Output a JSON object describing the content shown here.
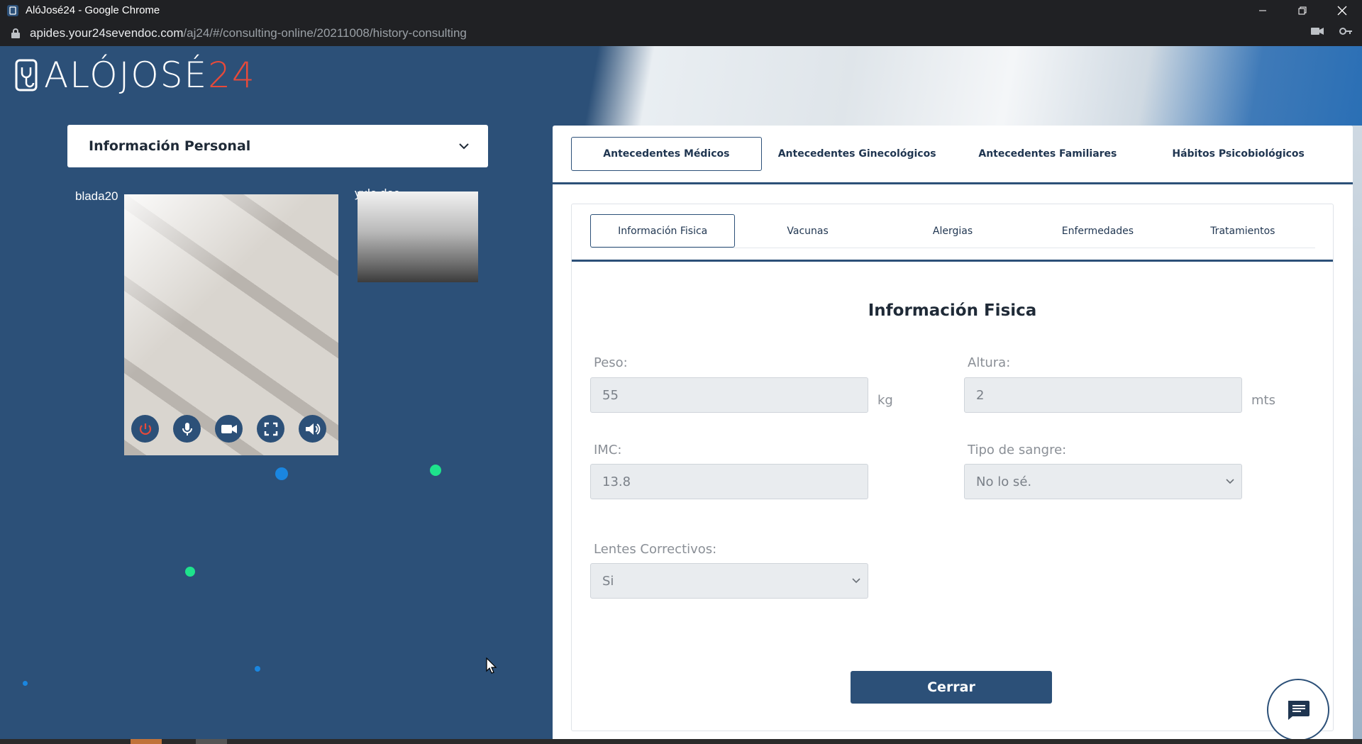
{
  "browser": {
    "window_title": "AlóJosé24 - Google Chrome",
    "url_host": "apides.your24sevendoc.com",
    "url_path": "/aj24/#/consulting-online/20211008/history-consulting"
  },
  "logo": {
    "text": "ALÓJOSÉ",
    "num": "24"
  },
  "personal_info": {
    "label": "Información Personal"
  },
  "video": {
    "local_name": "blada20",
    "remote_name": "yule.doc"
  },
  "tabs_main": [
    {
      "label": "Antecedentes Médicos",
      "active": true
    },
    {
      "label": "Antecedentes Ginecológicos",
      "active": false
    },
    {
      "label": "Antecedentes Familiares",
      "active": false
    },
    {
      "label": "Hábitos Psicobiológicos",
      "active": false
    }
  ],
  "tabs_sub": [
    {
      "label": "Información Fisica",
      "active": true
    },
    {
      "label": "Vacunas",
      "active": false
    },
    {
      "label": "Alergias",
      "active": false
    },
    {
      "label": "Enfermedades",
      "active": false
    },
    {
      "label": "Tratamientos",
      "active": false
    }
  ],
  "form": {
    "title": "Información Fisica",
    "peso": {
      "label": "Peso:",
      "value": "55",
      "unit": "kg"
    },
    "altura": {
      "label": "Altura:",
      "value": "2",
      "unit": "mts"
    },
    "imc": {
      "label": "IMC:",
      "value": "13.8"
    },
    "tipo_sangre": {
      "label": "Tipo de sangre:",
      "value": "No lo sé."
    },
    "lentes": {
      "label": "Lentes Correctivos:",
      "value": "Si"
    },
    "close_label": "Cerrar"
  },
  "colors": {
    "primary": "#2c5078",
    "accent_red": "#e84a3a",
    "dot_green": "#1ee38c",
    "dot_blue": "#1a86e0"
  }
}
